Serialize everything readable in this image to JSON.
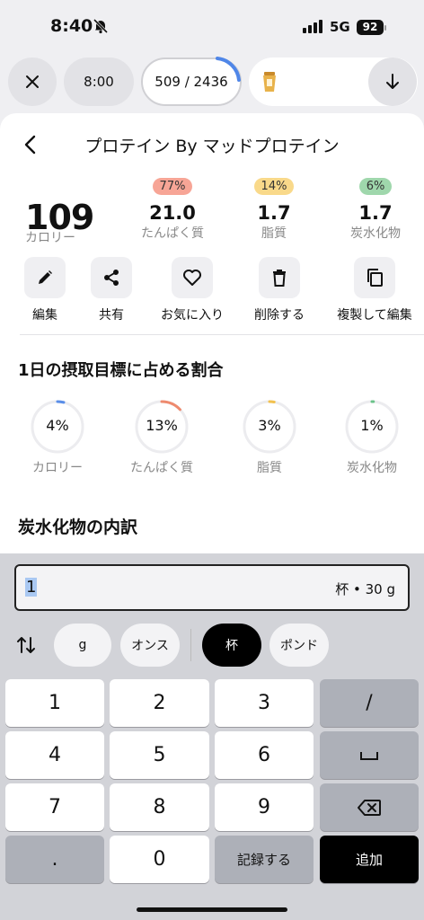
{
  "status_bar": {
    "time": "8:40",
    "network": "5G",
    "battery": "92"
  },
  "topbar": {
    "time_label": "8:00",
    "calories_label": "509 / 2436",
    "calories_progress": 0.209
  },
  "food": {
    "title": "プロテイン By マッドプロテイン",
    "calories": "109",
    "calories_label": "カロリー",
    "macros": [
      {
        "pct": "77%",
        "value": "21.0",
        "label": "たんぱく質",
        "color": "#f7a596"
      },
      {
        "pct": "14%",
        "value": "1.7",
        "label": "脂質",
        "color": "#f9d98a"
      },
      {
        "pct": "6%",
        "value": "1.7",
        "label": "炭水化物",
        "color": "#9fd7ac"
      }
    ]
  },
  "actions": [
    {
      "label": "編集",
      "icon": "pencil-icon"
    },
    {
      "label": "共有",
      "icon": "share-icon"
    },
    {
      "label": "お気に入り",
      "icon": "heart-icon"
    },
    {
      "label": "削除する",
      "icon": "trash-icon"
    },
    {
      "label": "複製して編集",
      "icon": "copy-icon"
    }
  ],
  "daily_goal": {
    "title": "1日の摂取目標に占める割合",
    "items": [
      {
        "pct": "4%",
        "label": "カロリー",
        "fraction": 0.04,
        "color": "#5a8ee8"
      },
      {
        "pct": "13%",
        "label": "たんぱく質",
        "fraction": 0.13,
        "color": "#ee8a6e"
      },
      {
        "pct": "3%",
        "label": "脂質",
        "fraction": 0.03,
        "color": "#f2c14e"
      },
      {
        "pct": "1%",
        "label": "炭水化物",
        "fraction": 0.01,
        "color": "#6bc38a"
      }
    ]
  },
  "carb_section_title": "炭水化物の内訳",
  "quantity": {
    "value": "1",
    "unit": "杯 • 30 g"
  },
  "units": [
    {
      "label": "g",
      "selected": false
    },
    {
      "label": "オンス",
      "selected": false
    },
    {
      "label": "杯",
      "selected": true
    },
    {
      "label": "ポンド",
      "selected": false
    }
  ],
  "keys": {
    "k1": "1",
    "k2": "2",
    "k3": "3",
    "slash": "/",
    "k4": "4",
    "k5": "5",
    "k6": "6",
    "space": "␣",
    "k7": "7",
    "k8": "8",
    "k9": "9",
    "dot": ".",
    "k0": "0",
    "log": "記録する",
    "add": "追加"
  }
}
